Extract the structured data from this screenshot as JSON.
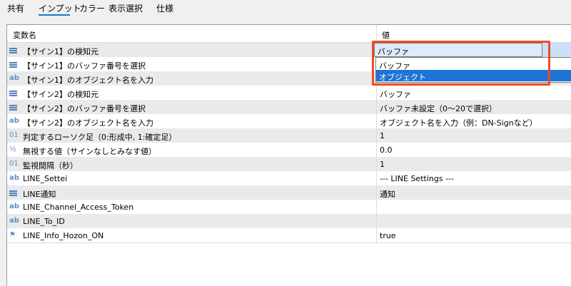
{
  "tabs": [
    {
      "label": "共有"
    },
    {
      "label": "インプット"
    },
    {
      "label": "カラー"
    },
    {
      "label": "表示選択"
    },
    {
      "label": "仕様"
    }
  ],
  "active_tab": "インプット",
  "table": {
    "headers": {
      "name": "変数名",
      "value": "値"
    },
    "rows": [
      {
        "icon": "enum-icon",
        "name": "【サイン1】の検知元",
        "value": "バッファ"
      },
      {
        "icon": "enum-icon",
        "name": "【サイン1】のバッファ番号を選択",
        "value": ""
      },
      {
        "icon": "string-icon",
        "name": "【サイン1】のオブジェクト名を入力",
        "value": ""
      },
      {
        "icon": "enum-icon",
        "name": "【サイン2】の検知元",
        "value": "バッファ"
      },
      {
        "icon": "enum-icon",
        "name": "【サイン2】のバッファ番号を選択",
        "value": "バッファ未設定（0〜20で選択）"
      },
      {
        "icon": "string-icon",
        "name": "【サイン2】のオブジェクト名を入力",
        "value": "オブジェクト名を入力（例：DN-Signなど）"
      },
      {
        "icon": "integer-icon",
        "name": "判定するローソク足（0:形成中, 1:確定足）",
        "value": "1"
      },
      {
        "icon": "double-icon",
        "name": "無視する値（サインなしとみなす値）",
        "value": "0.0"
      },
      {
        "icon": "integer-icon",
        "name": "監視間隔（秒）",
        "value": "1"
      },
      {
        "icon": "string-icon",
        "name": "LINE_Settei",
        "value": "--- LINE Settings ---"
      },
      {
        "icon": "enum-icon",
        "name": "LINE通知",
        "value": "通知"
      },
      {
        "icon": "string-icon",
        "name": "LINE_Channel_Access_Token",
        "value": ""
      },
      {
        "icon": "string-icon",
        "name": "LINE_To_ID",
        "value": ""
      },
      {
        "icon": "bool-icon",
        "name": "LINE_Info_Hozon_ON",
        "value": "true"
      }
    ]
  },
  "dropdown": {
    "selected": "バッファ",
    "options": [
      "バッファ",
      "オブジェクト"
    ],
    "highlighted": "オブジェクト"
  },
  "colors": {
    "accent": "#1e73d6",
    "outline": "#f04b23"
  }
}
